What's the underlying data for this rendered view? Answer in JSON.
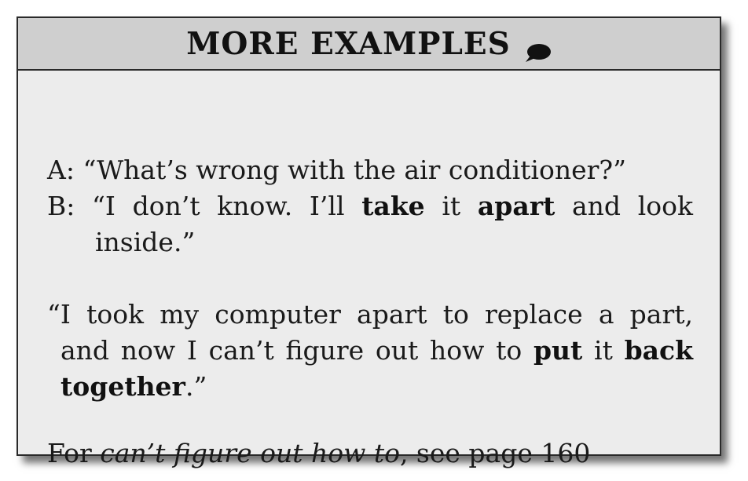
{
  "header": {
    "title": "MORE EXAMPLES",
    "icon": "speech-bubble-icon"
  },
  "example1": {
    "speaker_a": "A:",
    "line_a": "“What’s wrong with the air conditioner?”",
    "speaker_b": "B:",
    "b_part1": "“I don’t know. I’ll",
    "b_take": "take",
    "b_part2": "it",
    "b_apart": "apart",
    "b_part3": "and look",
    "b_line2": "inside.”"
  },
  "example2": {
    "line1": "“I took my computer apart to replace a part,",
    "line2_part1": "and now I can’t figure out how to",
    "line2_put": "put",
    "line2_part2": "it",
    "line2_back": "back",
    "line3_together": "together",
    "line3_end": ".”"
  },
  "reference": {
    "prefix": "For",
    "phrase": "can’t figure out how to",
    "suffix": ", see page 160"
  }
}
